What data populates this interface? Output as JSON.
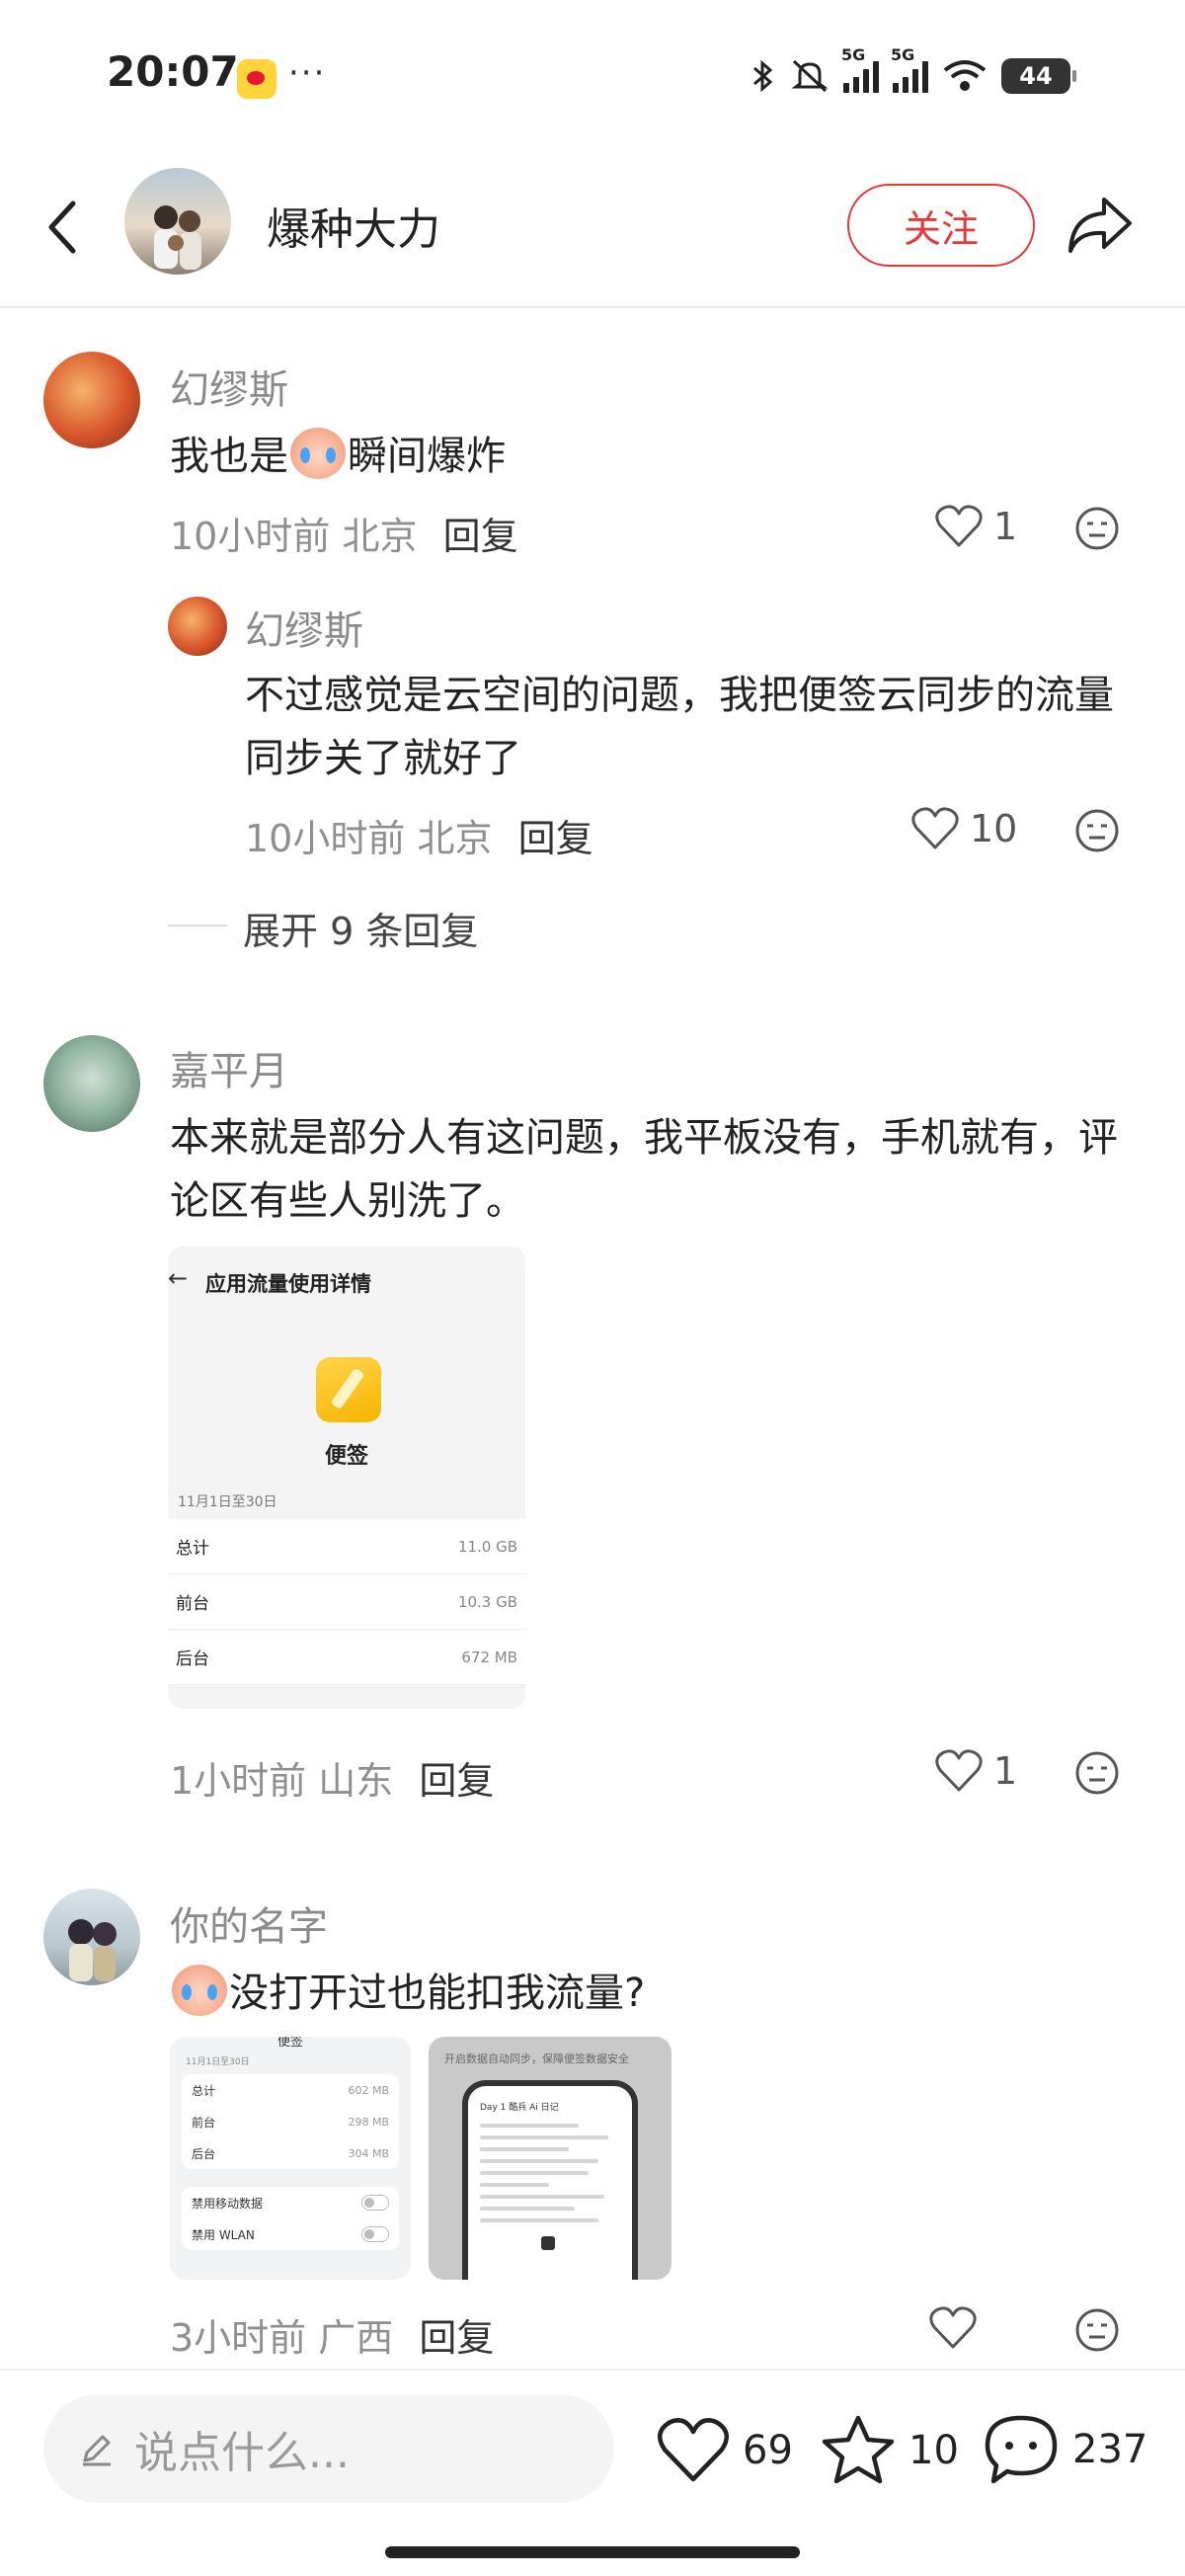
{
  "status_bar": {
    "time": "20:07",
    "more": "···",
    "network": "5G",
    "battery": "44",
    "icons": [
      "weibo-icon",
      "bluetooth-icon",
      "mute-icon",
      "signal-icon",
      "signal-icon",
      "wifi-icon",
      "battery-icon"
    ]
  },
  "header": {
    "title": "爆种大力",
    "follow_label": "关注",
    "icons": [
      "back-icon",
      "share-icon"
    ]
  },
  "comments": [
    {
      "user": "幻缪斯",
      "text_before": "我也是",
      "text_after": "瞬间爆炸",
      "time": "10小时前",
      "location": "北京",
      "reply_label": "回复",
      "likes": "1",
      "sub_reply": {
        "user": "幻缪斯",
        "text": "不过感觉是云空间的问题，我把便签云同步的流量同步关了就好了",
        "time": "10小时前",
        "location": "北京",
        "reply_label": "回复",
        "likes": "10"
      },
      "expand_label": "展开 9 条回复"
    },
    {
      "user": "嘉平月",
      "text": "本来就是部分人有这问题，我平板没有，手机就有，评论区有些人别洗了。",
      "attachment": {
        "title": "应用流量使用详情",
        "app_name": "便签",
        "date_range": "11月1日至30日",
        "rows": [
          {
            "label": "总计",
            "value": "11.0 GB"
          },
          {
            "label": "前台",
            "value": "10.3 GB"
          },
          {
            "label": "后台",
            "value": "672 MB"
          }
        ]
      },
      "time": "1小时前",
      "location": "山东",
      "reply_label": "回复",
      "likes": "1"
    },
    {
      "user": "你的名字",
      "text": "没打开过也能扣我流量?",
      "time": "3小时前",
      "location": "广西",
      "reply_label": "回复",
      "likes": "",
      "attachment_a": {
        "header": "便签",
        "date_range": "11月1日至30日",
        "rows": [
          {
            "label": "总计",
            "value": "602 MB"
          },
          {
            "label": "前台",
            "value": "298 MB"
          },
          {
            "label": "后台",
            "value": "304 MB"
          }
        ],
        "toggles": [
          "禁用移动数据",
          "禁用 WLAN"
        ]
      },
      "attachment_b": {
        "note": "开启数据自动同步，保障便签数据安全",
        "heading": "Day 1 酷兵 Ai 日记"
      }
    }
  ],
  "bottom_bar": {
    "placeholder": "说点什么...",
    "likes": "69",
    "favorites": "10",
    "comments": "237"
  }
}
